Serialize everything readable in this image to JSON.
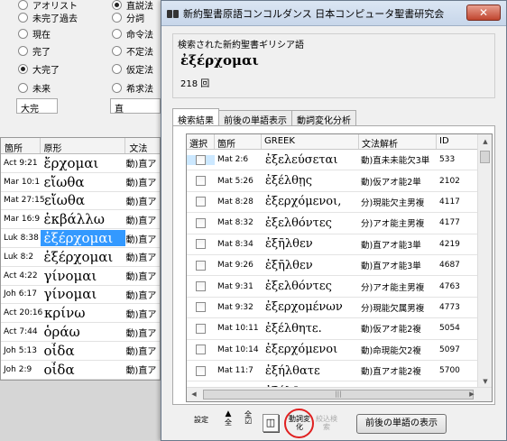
{
  "bg": {
    "tenses": [
      "アオリスト",
      "未完了過去",
      "現在",
      "完了",
      "大完了",
      "未来"
    ],
    "tense_value": "大完",
    "moods": [
      "直説法",
      "分詞",
      "命令法",
      "不定法",
      "仮定法",
      "希求法"
    ],
    "mood_value": "直",
    "table": {
      "headers": [
        "箇所",
        "原形",
        "文法"
      ],
      "rows": [
        {
          "loc": "Act 9:21",
          "gk": "ἔρχομαι",
          "ana": "動)直ア"
        },
        {
          "loc": "Mar 10:1",
          "gk": "εἴωθα",
          "ana": "動)直ア"
        },
        {
          "loc": "Mat 27:15",
          "gk": "εἴωθα",
          "ana": "動)直ア"
        },
        {
          "loc": "Mar 16:9",
          "gk": "ἐκβάλλω",
          "ana": "動)直ア"
        },
        {
          "loc": "Luk 8:38",
          "gk": "ἐξέρχομαι",
          "ana": "動)直ア"
        },
        {
          "loc": "Luk 8:2",
          "gk": "ἐξέρχομαι",
          "ana": "動)直ア"
        },
        {
          "loc": "Act 4:22",
          "gk": "γίνομαι",
          "ana": "動)直ア"
        },
        {
          "loc": "Joh 6:17",
          "gk": "γίνομαι",
          "ana": "動)直ア"
        },
        {
          "loc": "Act 20:16",
          "gk": "κρίνω",
          "ana": "動)直ア"
        },
        {
          "loc": "Act 7:44",
          "gk": "ὁράω",
          "ana": "動)直ア"
        },
        {
          "loc": "Joh 5:13",
          "gk": "οἶδα",
          "ana": "動)直ア"
        },
        {
          "loc": "Joh 2:9",
          "gk": "οἶδα",
          "ana": "動)直ア"
        },
        {
          "loc": "Joh 6:64",
          "gk": "οἶδα",
          "ana": "動)直ア"
        }
      ]
    }
  },
  "dialog": {
    "title": "新約聖書原語コンコルダンス 日本コンピュータ聖書研究会",
    "close": "✕",
    "found_label": "検索された新約聖書ギリシア語",
    "word": "ἐξέρχομαι",
    "count": "218 回",
    "tabs": [
      "検索結果",
      "前後の単語表示",
      "動詞変化分析"
    ],
    "headers": [
      "選択",
      "箇所",
      "GREEK",
      "文法解析",
      "ID"
    ],
    "rows": [
      {
        "loc": "Mat 2:6",
        "gk": "ἐξελεύσεται",
        "ana": "動)直未未能欠3単",
        "id": "533"
      },
      {
        "loc": "Mat 5:26",
        "gk": "ἐξέλθῃς",
        "ana": "動)仮アオ能2単",
        "id": "2102"
      },
      {
        "loc": "Mat 8:28",
        "gk": "ἐξερχόμενοι,",
        "ana": "分)現能欠主男複",
        "id": "4117"
      },
      {
        "loc": "Mat 8:32",
        "gk": "ἐξελθόντες",
        "ana": "分)アオ能主男複",
        "id": "4177"
      },
      {
        "loc": "Mat 8:34",
        "gk": "ἐξῆλθεν",
        "ana": "動)直アオ能3単",
        "id": "4219"
      },
      {
        "loc": "Mat 9:26",
        "gk": "ἐξῆλθεν",
        "ana": "動)直アオ能3単",
        "id": "4687"
      },
      {
        "loc": "Mat 9:31",
        "gk": "ἐξελθόντες",
        "ana": "分)アオ能主男複",
        "id": "4763"
      },
      {
        "loc": "Mat 9:32",
        "gk": "ἐξερχομένων",
        "ana": "分)現能欠属男複",
        "id": "4773"
      },
      {
        "loc": "Mat 10:11",
        "gk": "ἐξέλθητε.",
        "ana": "動)仮アオ能2複",
        "id": "5054"
      },
      {
        "loc": "Mat 10:14",
        "gk": "ἐξερχόμενοι",
        "ana": "動)命現能欠2複",
        "id": "5097"
      },
      {
        "loc": "Mat 11:7",
        "gk": "ἐξήλθατε",
        "ana": "動)直アオ能2複",
        "id": "5700"
      },
      {
        "loc": "Mat 11:8",
        "gk": "ἐξήλθατε",
        "ana": "動)直アオ能2複",
        "id": "5711"
      },
      {
        "loc": "Mat 11:9",
        "gk": "ἐξήλθατε",
        "ana": "動)直アオ能2複",
        "id": "5730"
      },
      {
        "loc": "Mat 12:14",
        "gk": "ἐξελθόντες",
        "ana": "分)アオ能主男複",
        "id": "6213"
      }
    ],
    "toolbar": {
      "settings": "設定",
      "sort_up": "全",
      "sort_down": "全",
      "verb_change": "動詞変化",
      "search_again": "絞込検索"
    },
    "context_button": "前後の単語の表示"
  }
}
